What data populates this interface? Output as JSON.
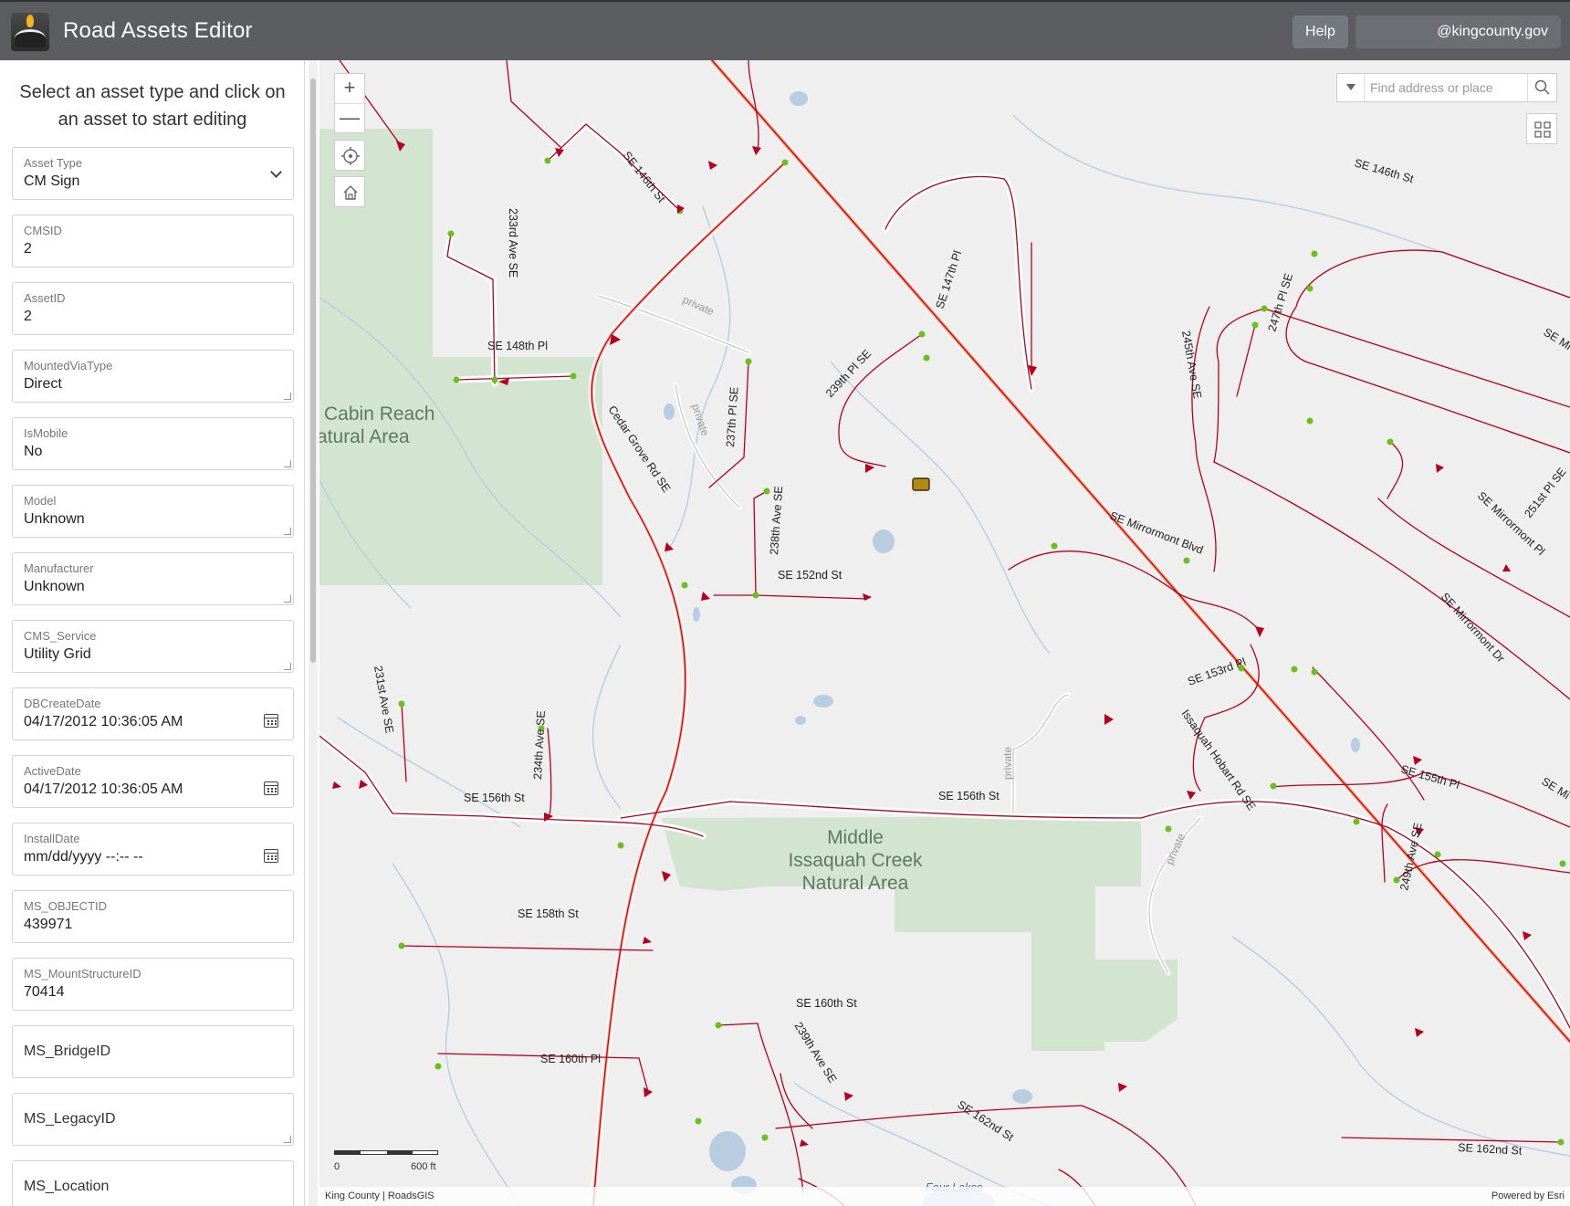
{
  "header": {
    "title": "Road Assets Editor",
    "help_label": "Help",
    "user": "@kingcounty.gov"
  },
  "sidebar": {
    "instructions": "Select an asset type and click on an asset to start editing",
    "asset_type": {
      "label": "Asset Type",
      "value": "CM Sign"
    },
    "fields": [
      {
        "label": "CMSID",
        "value": "2"
      },
      {
        "label": "AssetID",
        "value": "2"
      },
      {
        "label": "MountedViaType",
        "value": "Direct"
      },
      {
        "label": "IsMobile",
        "value": "No"
      },
      {
        "label": "Model",
        "value": "Unknown"
      },
      {
        "label": "Manufacturer",
        "value": "Unknown"
      },
      {
        "label": "CMS_Service",
        "value": "Utility Grid"
      },
      {
        "label": "DBCreateDate",
        "value": "04/17/2012 10:36:05  AM"
      },
      {
        "label": "ActiveDate",
        "value": "04/17/2012 10:36:05  AM"
      },
      {
        "label": "InstallDate",
        "value": "mm/dd/yyyy --:--  --"
      },
      {
        "label": "MS_OBJECTID",
        "value": "439971"
      },
      {
        "label": "MS_MountStructureID",
        "value": "70414"
      },
      {
        "label": "MS_BridgeID",
        "value": ""
      },
      {
        "label": "MS_LegacyID",
        "value": ""
      },
      {
        "label": "MS_Location",
        "value": ""
      }
    ]
  },
  "map": {
    "zoom_in": "+",
    "zoom_out": "—",
    "search_placeholder": "Find address or place",
    "scale_zero": "0",
    "scale_label": "600 ft",
    "attribution_left": "King County | RoadsGIS",
    "attribution_right": "Powered by Esri",
    "road_labels": {
      "se146_a": "SE 146th St",
      "ave233": "233rd Ave SE",
      "se148": "SE 148th Pl",
      "pl147": "SE 147th Pl",
      "se146_b": "SE 146th St",
      "pl247": "247th Pl SE",
      "ave245": "245th Ave SE",
      "pl239": "239th Pl SE",
      "pl237": "237th Pl SE",
      "cedar": "Cedar Grove Rd SE",
      "ave238": "238th Ave SE",
      "se152": "SE 152nd St",
      "mirrormont_blvd": "SE Mirrormont Blvd",
      "mirrormont_pl": "SE Mirrormont Pl",
      "pl251": "251st Pl SE",
      "mirrormont_dr": "SE Mirrormont Dr",
      "se_mi": "SE Mi",
      "ave231": "231st Ave SE",
      "ave234": "234th Ave SE",
      "se156_a": "SE 156th St",
      "se156_b": "SE 156th St",
      "se153": "SE 153rd Pl",
      "issaquah_hobart": "Issaquah Hobart Rd SE",
      "se155": "SE 155th Pl",
      "se_mi_b": "SE Mi",
      "ave249": "249th Ave SE",
      "se158": "SE 158th St",
      "se160_a": "SE 160th St",
      "se160_pl": "SE 160th Pl",
      "ave239": "239th Ave SE",
      "se162_a": "SE 162nd St",
      "se162_b": "SE 162nd St",
      "private": "private",
      "four_lakes": "Four Lakes"
    },
    "areas": {
      "cabin_1": "Cabin Reach",
      "cabin_2": "atural Area",
      "middle_1": "Middle",
      "middle_2": "Issaquah Creek",
      "middle_3": "Natural Area"
    }
  }
}
